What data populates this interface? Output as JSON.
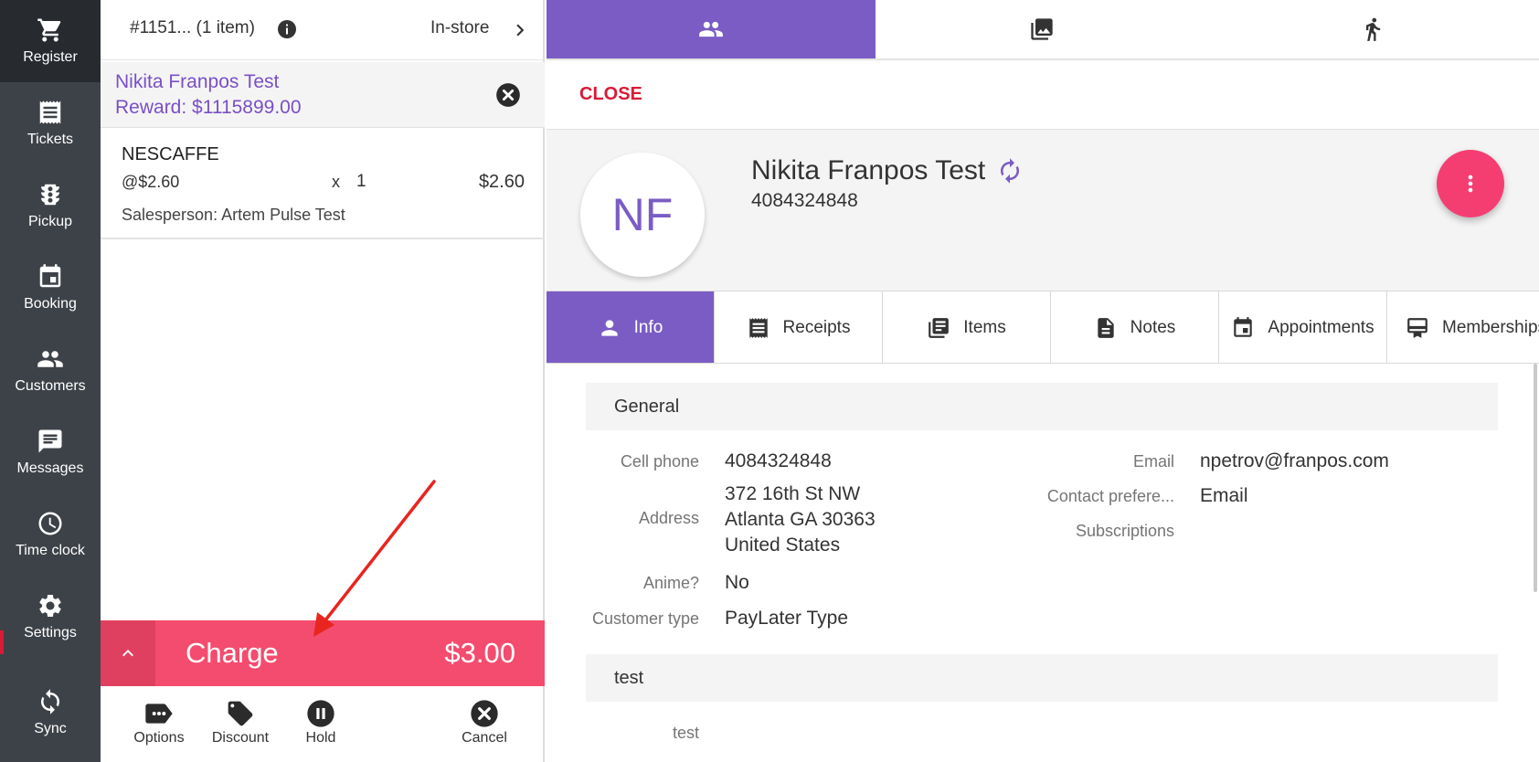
{
  "nav": {
    "items": [
      {
        "label": "Register",
        "icon": "cart-icon"
      },
      {
        "label": "Tickets",
        "icon": "receipt-icon"
      },
      {
        "label": "Pickup",
        "icon": "traffic-light-icon"
      },
      {
        "label": "Booking",
        "icon": "calendar-icon"
      },
      {
        "label": "Customers",
        "icon": "people-icon"
      },
      {
        "label": "Messages",
        "icon": "message-icon"
      },
      {
        "label": "Time clock",
        "icon": "clock-icon"
      },
      {
        "label": "Settings",
        "icon": "gear-icon"
      },
      {
        "label": "Sync",
        "icon": "sync-icon"
      }
    ],
    "active": "Register"
  },
  "ticket": {
    "number": "#1151... (1 item)",
    "mode": "In-store",
    "customer_name": "Nikita Franpos Test",
    "reward": "Reward: $1115899.00",
    "line": {
      "name": "NESCAFFE",
      "unit_price": "@$2.60",
      "x": "x",
      "qty": "1",
      "total": "$2.60",
      "salesperson": "Salesperson: Artem Pulse Test"
    },
    "charge_label": "Charge",
    "charge_amount": "$3.00",
    "actions": {
      "options": "Options",
      "discount": "Discount",
      "hold": "Hold",
      "cancel": "Cancel"
    }
  },
  "top_tabs": [
    "people-icon",
    "photo-icon",
    "walk-icon"
  ],
  "close_label": "CLOSE",
  "customer": {
    "initials": "NF",
    "name": "Nikita Franpos Test",
    "phone": "4084324848"
  },
  "tabs": [
    {
      "label": "Info",
      "icon": "person-icon",
      "active": true
    },
    {
      "label": "Receipts",
      "icon": "receipt-icon"
    },
    {
      "label": "Items",
      "icon": "library-icon"
    },
    {
      "label": "Notes",
      "icon": "note-icon"
    },
    {
      "label": "Appointments",
      "icon": "calendar-icon"
    },
    {
      "label": "Memberships",
      "icon": "membership-icon"
    }
  ],
  "general": {
    "title": "General",
    "cell_phone_label": "Cell phone",
    "cell_phone": "4084324848",
    "address_label": "Address",
    "address_line1": "372 16th St NW",
    "address_line2": "Atlanta GA 30363",
    "address_line3": "United States",
    "anime_label": "Anime?",
    "anime": "No",
    "customer_type_label": "Customer type",
    "customer_type": "PayLater Type",
    "email_label": "Email",
    "email": "npetrov@franpos.com",
    "contact_pref_label": "Contact prefere...",
    "contact_pref": "Email",
    "subscriptions_label": "Subscriptions"
  },
  "test_section": {
    "title": "test",
    "field_label": "test"
  },
  "colors": {
    "accent": "#7b5cc4",
    "charge": "#f44c6e",
    "danger": "#d81b36",
    "nav_bg": "#3d4248"
  }
}
